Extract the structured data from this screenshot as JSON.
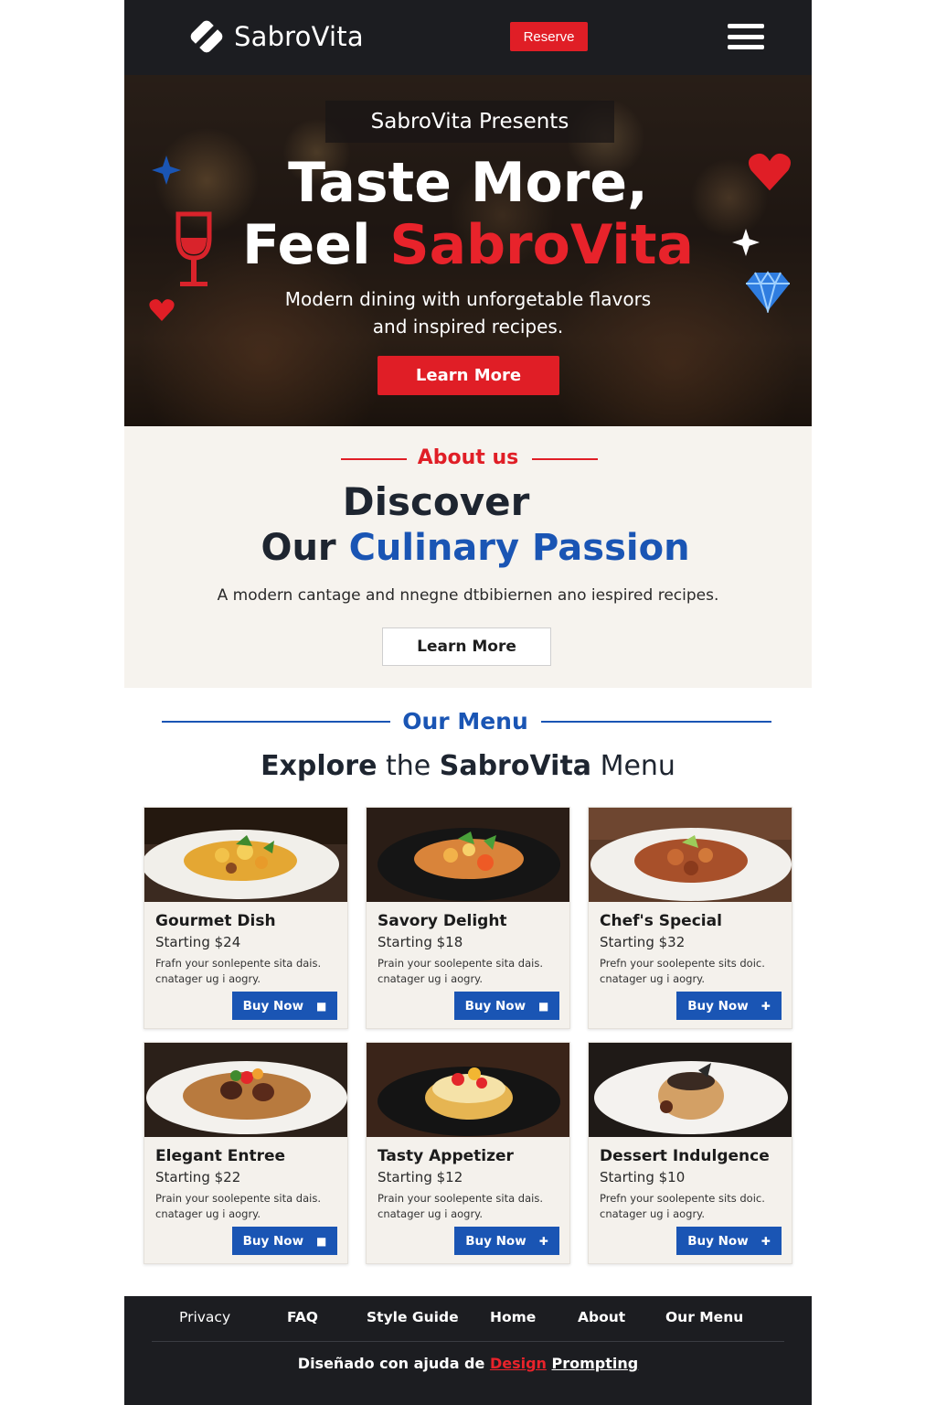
{
  "header": {
    "brand": "SabroVita",
    "reserve_label": "Reserve",
    "menu_icon": "hamburger-menu-icon"
  },
  "hero": {
    "kicker": "SabroVita Presents",
    "title_line1": "Taste More,",
    "title_line2_prefix": "Feel ",
    "title_line2_accent": "SabroVita",
    "subtitle_line1": "Modern dining with unforgetable flavors",
    "subtitle_line2": "and inspired recipes.",
    "button_label": "Learn More",
    "decorations": [
      "blue-sparkle-icon",
      "wine-glass-icon",
      "small-heart-icon",
      "heart-icon",
      "white-sparkle-icon",
      "diamond-icon"
    ]
  },
  "about": {
    "eyebrow": "About us",
    "title_line1": "Discover",
    "title_line2_prefix": "Our ",
    "title_line2_accent": "Culinary Passion",
    "text": "A modern cantage and nnegne dtbibiernen ano iespired recipes.",
    "button_label": "Learn More"
  },
  "menu": {
    "eyebrow": "Our Menu",
    "title_b1": "Explore",
    "title_mid": " the ",
    "title_b2": "SabroVita",
    "title_end": " Menu",
    "items": [
      {
        "name": "Gourmet Dish",
        "price": "Starting $24",
        "desc": "Frafn your sonlepente sita dais. cnatager ug i aogry.",
        "button": "Buy Now",
        "icon": "stop-icon"
      },
      {
        "name": "Savory Delight",
        "price": "Starting $18",
        "desc": "Prain your soolepente sita dais. cnatager ug i aogry.",
        "button": "Buy Now",
        "icon": "stop-icon"
      },
      {
        "name": "Chef's Special",
        "price": "Starting $32",
        "desc": "Prefn your soolepente sits doic. cnatager ug i aogry.",
        "button": "Buy Now",
        "icon": "plus-icon"
      },
      {
        "name": "Elegant Entree",
        "price": "Starting $22",
        "desc": "Prain your soolepente sita dais. cnatager ug i aogry.",
        "button": "Buy Now",
        "icon": "stop-icon"
      },
      {
        "name": "Tasty Appetizer",
        "price": "Starting $12",
        "desc": "Prain your soolepente sita dais. cnatager ug i aogry.",
        "button": "Buy Now",
        "icon": "plus-icon"
      },
      {
        "name": "Dessert Indulgence",
        "price": "Starting $10",
        "desc": "Prefn your soolepente sits doic. cnatager ug i aogry.",
        "button": "Buy Now",
        "icon": "plus-icon"
      }
    ]
  },
  "footer": {
    "links": [
      "Privacy",
      "FAQ",
      "Style Guide",
      "Home",
      "About",
      "Our Menu"
    ],
    "credit_prefix": "Diseñado con ajuda de ",
    "credit_red": "Design",
    "credit_space": " ",
    "credit_end": "Prompting"
  },
  "colors": {
    "dark": "#1c1d21",
    "red": "#e01e26",
    "blue": "#1a55b4",
    "cream": "#f6f3ee"
  }
}
